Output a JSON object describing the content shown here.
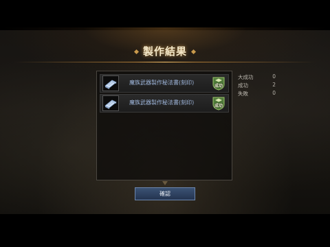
{
  "dialog": {
    "title": "製作結果",
    "results": [
      {
        "item_name": "魔族武器製作秘法書(刻印)",
        "item_icon": "scroll-icon",
        "status": "成功",
        "status_icon": "shield-badge-icon"
      },
      {
        "item_name": "魔族武器製作秘法書(刻印)",
        "item_icon": "scroll-icon",
        "status": "成功",
        "status_icon": "shield-badge-icon"
      }
    ],
    "stats": [
      {
        "label": "大成功",
        "value": "0"
      },
      {
        "label": "成功",
        "value": "2"
      },
      {
        "label": "失敗",
        "value": "0"
      }
    ],
    "confirm_label": "確認"
  },
  "colors": {
    "title": "#f3e7c8",
    "item_name": "#9fb7dd",
    "badge": "#4f7a3a",
    "button": "#2f4463",
    "accent_line": "#c99a4c"
  }
}
